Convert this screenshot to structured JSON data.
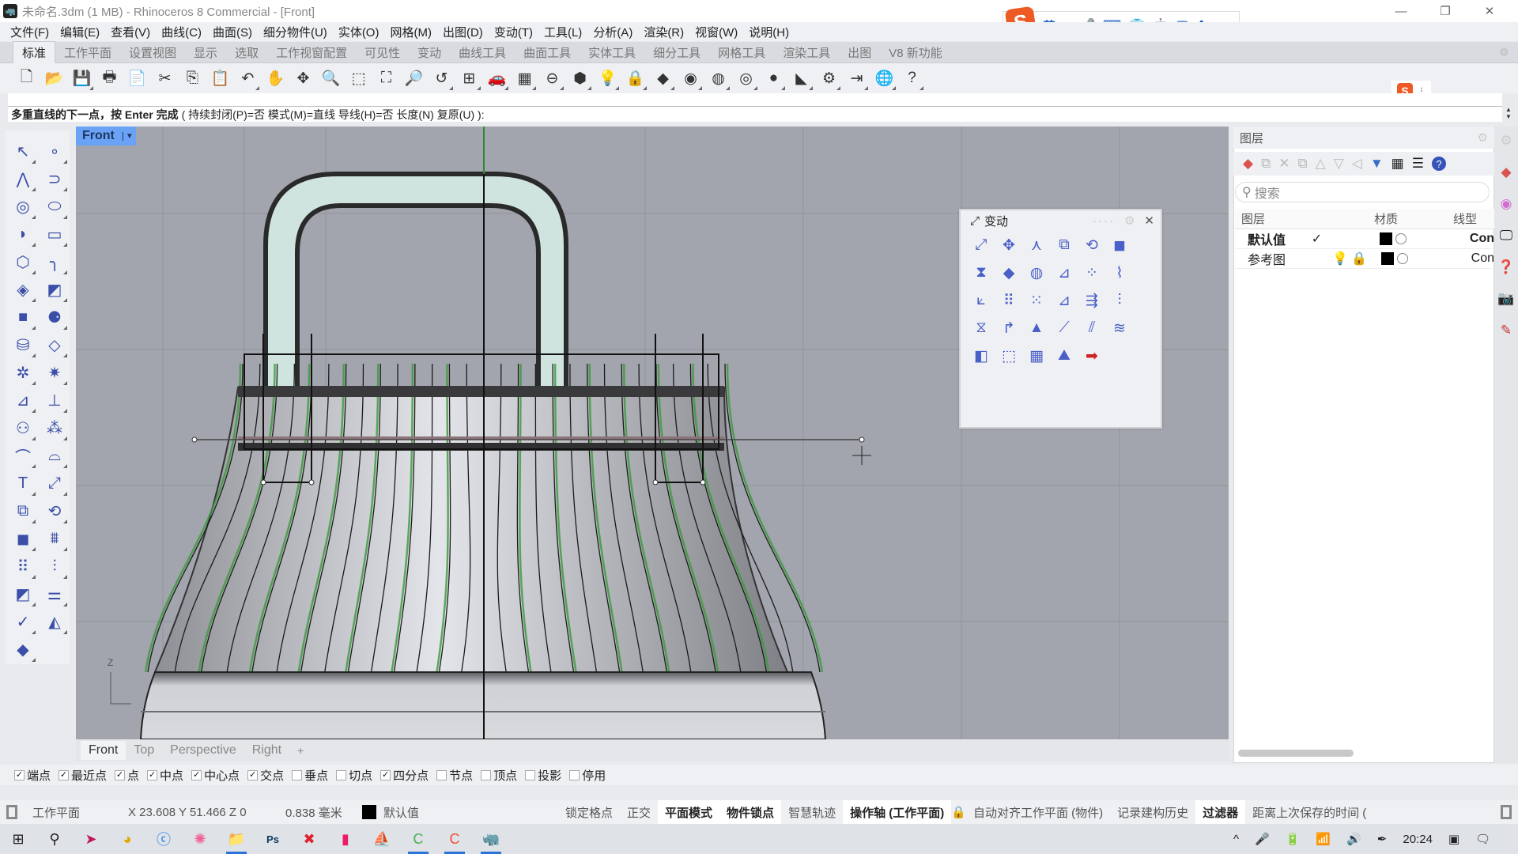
{
  "window": {
    "title": "未命名.3dm (1 MB) - Rhinoceros 8 Commercial - [Front]",
    "controls": [
      "minimize",
      "restore",
      "close"
    ]
  },
  "ime": {
    "mode_label": "英",
    "items": [
      "punctuation-icon",
      "microphone-icon",
      "keyboard-icon",
      "skin-icon",
      "robot-icon",
      "apps-icon",
      "settings-icon"
    ]
  },
  "menu": [
    "文件(F)",
    "编辑(E)",
    "查看(V)",
    "曲线(C)",
    "曲面(S)",
    "细分物件(U)",
    "实体(O)",
    "网格(M)",
    "出图(D)",
    "变动(T)",
    "工具(L)",
    "分析(A)",
    "渲染(R)",
    "视窗(W)",
    "说明(H)"
  ],
  "toolbar_tabs": {
    "active": "标准",
    "tabs": [
      "标准",
      "工作平面",
      "设置视图",
      "显示",
      "选取",
      "工作视窗配置",
      "可见性",
      "变动",
      "曲线工具",
      "曲面工具",
      "实体工具",
      "细分工具",
      "网格工具",
      "渲染工具",
      "出图",
      "V8 新功能"
    ]
  },
  "main_toolbar": [
    {
      "name": "new-icon",
      "glyph": "🗋"
    },
    {
      "name": "open-icon",
      "glyph": "📂"
    },
    {
      "name": "save-icon",
      "glyph": "💾",
      "flyout": true
    },
    {
      "name": "print-icon",
      "glyph": "🖶"
    },
    {
      "name": "import-icon",
      "glyph": "📄"
    },
    {
      "name": "cut-icon",
      "glyph": "✂"
    },
    {
      "name": "copy-icon",
      "glyph": "⎘"
    },
    {
      "name": "paste-icon",
      "glyph": "📋"
    },
    {
      "name": "undo-icon",
      "glyph": "↶",
      "flyout": true
    },
    {
      "name": "pan-icon",
      "glyph": "✋"
    },
    {
      "name": "rotate-view-icon",
      "glyph": "✥"
    },
    {
      "name": "zoom-dynamic-icon",
      "glyph": "🔍"
    },
    {
      "name": "zoom-window-icon",
      "glyph": "⬚"
    },
    {
      "name": "zoom-extents-icon",
      "glyph": "⛶"
    },
    {
      "name": "zoom-selected-icon",
      "glyph": "🔎"
    },
    {
      "name": "undo-view-icon",
      "glyph": "↺",
      "flyout": true
    },
    {
      "name": "viewport-layout-icon",
      "glyph": "⊞",
      "flyout": true
    },
    {
      "name": "car-icon",
      "glyph": "🚗",
      "flyout": true
    },
    {
      "name": "grid-snap-icon",
      "glyph": "▦",
      "flyout": true
    },
    {
      "name": "object-snap-icon",
      "glyph": "⊖",
      "flyout": true
    },
    {
      "name": "select-shapes-icon",
      "glyph": "⬢",
      "flyout": true
    },
    {
      "name": "light-bulb-icon",
      "glyph": "💡",
      "flyout": true
    },
    {
      "name": "lock-icon",
      "glyph": "🔒",
      "flyout": true
    },
    {
      "name": "layer-icon",
      "glyph": "◆",
      "flyout": true
    },
    {
      "name": "color-wheel-icon",
      "glyph": "◉",
      "flyout": true
    },
    {
      "name": "wireframe-sphere-icon",
      "glyph": "◍",
      "flyout": true
    },
    {
      "name": "render-sphere-icon",
      "glyph": "◎",
      "flyout": true
    },
    {
      "name": "material-sphere-icon",
      "glyph": "●",
      "flyout": true
    },
    {
      "name": "cone-light-icon",
      "glyph": "◣",
      "flyout": true
    },
    {
      "name": "gear-icon",
      "glyph": "⚙",
      "flyout": true
    },
    {
      "name": "dimension-icon",
      "glyph": "⇥",
      "flyout": true
    },
    {
      "name": "globe-icon",
      "glyph": "🌐",
      "flyout": true
    },
    {
      "name": "help-icon",
      "glyph": "?",
      "flyout": true
    }
  ],
  "command": {
    "prompt_bold": "多重直线的下一点，按 Enter 完成",
    "options": "( 持续封闭(P)=否  模式(M)=直线  导线(H)=否  长度(N)  复原(U) ):"
  },
  "left_toolbar": [
    "select-arrow-icon",
    "point-icon",
    "polyline-icon",
    "curve-icon",
    "circle-icon",
    "ellipse-icon",
    "arc-icon",
    "rectangle-icon",
    "polygon-icon",
    "fillet-curve-icon",
    "surface-corner-icon",
    "extrude-surface-icon",
    "box-icon",
    "sphere-group-icon",
    "cylinder-icon",
    "loft-surface-icon",
    "puzzle-icon",
    "explode-icon",
    "trim-icon",
    "split-icon",
    "boolean-union-icon",
    "boolean-split-icon",
    "fillet-edge-icon",
    "blend-edge-icon",
    "text-icon",
    "move-icon",
    "copy-icon",
    "rotate-icon",
    "solid-edit-icon",
    "extrude-pattern-icon",
    "array-icon",
    "align-icon",
    "orient-icon",
    "mirror-icon",
    "check-icon",
    "solids-icon",
    "pyramid-icon"
  ],
  "viewport": {
    "name": "Front",
    "axis_label": "Z",
    "bottom_tabs": [
      "Front",
      "Top",
      "Perspective",
      "Right"
    ],
    "active_tab": "Front",
    "add_tab_glyph": "+"
  },
  "transform_panel": {
    "title": "变动",
    "tools": [
      "move-icon",
      "gumball-icon",
      "set-pt-icon",
      "copy-icon",
      "rotate-icon",
      "box-edit-icon",
      "mirror-icon",
      "scale-icon",
      "rotate3d-icon",
      "orient-icon",
      "orient-2pt-icon",
      "flow-icon",
      "orient-3pt-icon",
      "array-icon",
      "polar-array-icon",
      "project-icon",
      "array-curve-icon",
      "align-icon",
      "twist-icon",
      "bend-icon",
      "taper-icon",
      "flow-along-srf-icon",
      "shear-icon",
      "smooth-icon",
      "cage-icon",
      "cage-edit-icon",
      "splop-icon",
      "soft-edit-icon",
      "more-arrow-icon"
    ]
  },
  "layers_panel": {
    "title": "图层",
    "search_placeholder": "搜索",
    "columns": [
      "图层",
      "材质",
      "线型"
    ],
    "rows": [
      {
        "name": "默认值",
        "current": true,
        "color": "#000000",
        "linetype": "Con"
      },
      {
        "name": "参考图",
        "current": false,
        "color": "#000000",
        "linetype": "Con",
        "locked": true,
        "visible": true
      }
    ],
    "tools": [
      "new-layer-icon",
      "new-sublayer-icon",
      "delete-icon",
      "copy-layer-icon",
      "move-up-icon",
      "move-down-icon",
      "move-left-icon",
      "filter-icon",
      "table-icon",
      "menu-icon",
      "help-icon"
    ]
  },
  "osnap": [
    {
      "label": "端点",
      "checked": true
    },
    {
      "label": "最近点",
      "checked": true
    },
    {
      "label": "点",
      "checked": true
    },
    {
      "label": "中点",
      "checked": true
    },
    {
      "label": "中心点",
      "checked": true
    },
    {
      "label": "交点",
      "checked": true
    },
    {
      "label": "垂点",
      "checked": false
    },
    {
      "label": "切点",
      "checked": false
    },
    {
      "label": "四分点",
      "checked": true
    },
    {
      "label": "节点",
      "checked": false
    },
    {
      "label": "顶点",
      "checked": false
    },
    {
      "label": "投影",
      "checked": false
    },
    {
      "label": "停用",
      "checked": false
    }
  ],
  "status": {
    "cplane": "工作平面",
    "coords": "X 23.608 Y 51.466 Z 0",
    "distance": "0.838 毫米",
    "layer": "默认值",
    "toggles": [
      {
        "label": "锁定格点",
        "on": false
      },
      {
        "label": "正交",
        "on": false
      },
      {
        "label": "平面模式",
        "on": true
      },
      {
        "label": "物件锁点",
        "on": true
      },
      {
        "label": "智慧轨迹",
        "on": false
      },
      {
        "label": "操作轴 (工作平面)",
        "on": true
      },
      {
        "label": "自动对齐工作平面 (物件)",
        "on": false
      },
      {
        "label": "记录建构历史",
        "on": false
      },
      {
        "label": "过滤器",
        "on": true
      },
      {
        "label": "距离上次保存的时间 (",
        "on": false
      }
    ]
  },
  "taskbar": {
    "apps": [
      "windows-start-icon",
      "search-icon",
      "feishu-icon",
      "chrome-icon",
      "browser-icon",
      "colorful-app-icon",
      "file-explorer-icon",
      "photoshop-icon",
      "xmind-icon",
      "bookmark-app-icon",
      "rhino-shortcut-icon",
      "camtasia-green-icon",
      "camtasia-red-icon",
      "rhino-icon"
    ],
    "clock": "20:24"
  },
  "colors": {
    "viewport_bg": "#a2a5ad",
    "viewport_title": "#6aa3f6",
    "accent_green": "#3c9a3c"
  }
}
